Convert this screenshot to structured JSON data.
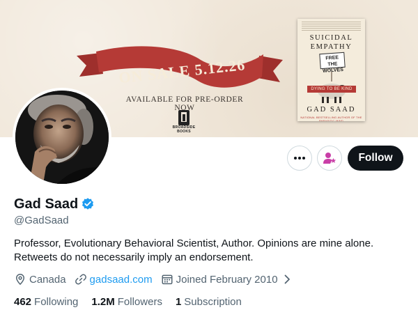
{
  "banner": {
    "sale_text": "ON SALE 5.12.26",
    "preorder_text": "AVAILABLE FOR PRE-ORDER NOW",
    "publisher": "BROADSIDE BOOKS",
    "book": {
      "title_line1": "SUICIDAL",
      "title_line2": "EMPATHY",
      "sign_line1": "FREE",
      "sign_line2": "THE",
      "sign_line3": "WOLVES",
      "subtitle": "DYING TO BE KIND",
      "author": "GAD SAAD",
      "footer": "NATIONAL BESTSELLING AUTHOR OF THE PARASITIC MIND"
    }
  },
  "profile": {
    "display_name": "Gad Saad",
    "handle": "@GadSaad",
    "bio": "Professor, Evolutionary Behavioral Scientist, Author. Opinions are mine alone. Retweets do not necessarily imply an endorsement.",
    "location": "Canada",
    "website": "gadsaad.com",
    "joined": "Joined February 2010"
  },
  "actions": {
    "more_label": "···",
    "follow_label": "Follow"
  },
  "stats": {
    "following_count": "462",
    "following_label": "Following",
    "followers_count": "1.2M",
    "followers_label": "Followers",
    "subscription_count": "1",
    "subscription_label": "Subscription"
  },
  "icons": {
    "more": "more-horizontal-icon",
    "subscribe": "subscribe-person-star-icon",
    "verified": "verified-badge-icon",
    "location": "location-pin-icon",
    "link": "link-icon",
    "calendar": "calendar-icon",
    "chevron": "chevron-right-icon"
  },
  "colors": {
    "accent": "#1d9bf0",
    "follow_bg": "#0f1419",
    "secondary_text": "#536471",
    "ribbon_red": "#b53a36",
    "subscribe_purple": "#c93ea7"
  }
}
